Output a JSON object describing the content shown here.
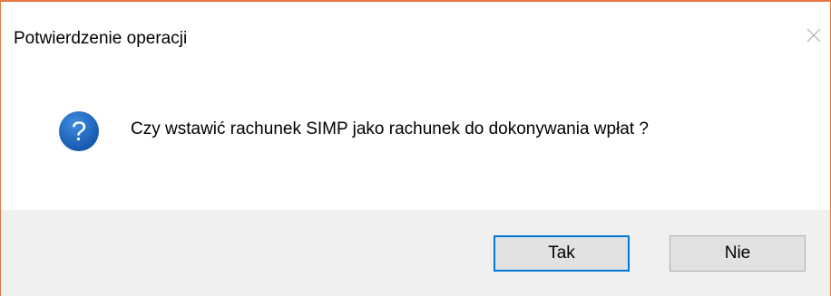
{
  "window": {
    "title": "Potwierdzenie operacji",
    "close_icon": "close-icon"
  },
  "message": {
    "icon": "question-icon",
    "text": "Czy wstawić rachunek SIMP jako rachunek do dokonywania wpłat ?"
  },
  "buttons": {
    "yes_label": "Tak",
    "no_label": "Nie"
  },
  "colors": {
    "window_border": "#e8773f",
    "icon_blue": "#1c66b8",
    "default_button_border": "#0078d7",
    "footer_background": "#f0f0f0",
    "button_background": "#e1e1e1"
  }
}
